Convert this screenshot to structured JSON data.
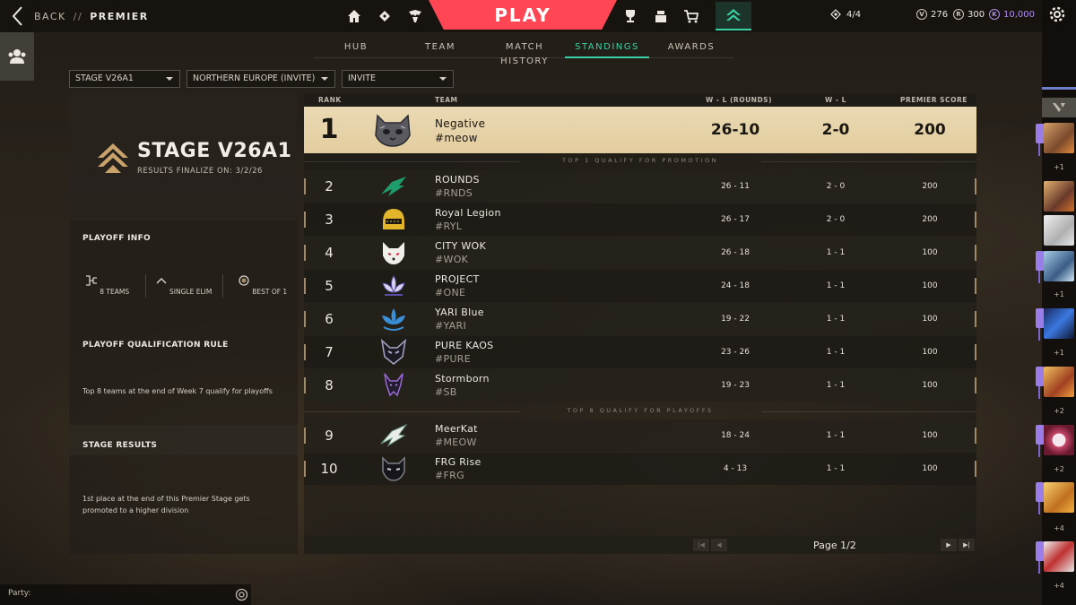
{
  "header": {
    "back_label": "BACK",
    "separator": "//",
    "breadcrumb": "PREMIER",
    "play_label": "PLAY",
    "party_count": "4/4",
    "currency": [
      {
        "icon": "valorant-points-icon",
        "value": "276"
      },
      {
        "icon": "radianite-icon",
        "value": "300"
      },
      {
        "icon": "kingdom-credits-icon",
        "value": "10,000",
        "color": "#b08cf0"
      }
    ]
  },
  "subtabs": [
    {
      "label": "HUB"
    },
    {
      "label": "TEAM"
    },
    {
      "label": "MATCH HISTORY"
    },
    {
      "label": "STANDINGS",
      "active": true
    },
    {
      "label": "AWARDS"
    }
  ],
  "filters": {
    "stage": "STAGE V26A1",
    "region": "NORTHERN EUROPE (INVITE)",
    "division": "INVITE"
  },
  "stage": {
    "title": "STAGE V26A1",
    "finalize": "RESULTS FINALIZE ON: 3/2/26"
  },
  "playoff": {
    "title": "PLAYOFF INFO",
    "items": [
      {
        "icon": "bracket-icon",
        "label": "8 TEAMS"
      },
      {
        "icon": "chevron-up-icon",
        "label": "SINGLE ELIM"
      },
      {
        "icon": "circle-dot-icon",
        "label": "BEST OF 1"
      }
    ],
    "rule_title": "PLAYOFF QUALIFICATION RULE",
    "rule_text": "Top 8 teams at the end of Week 7 qualify for playoffs",
    "results_title": "STAGE RESULTS",
    "results_text": "1st place at the end of this Premier Stage gets promoted to a higher division"
  },
  "table": {
    "headers": {
      "rank": "RANK",
      "team": "TEAM",
      "rounds": "W - L (ROUNDS)",
      "wl": "W - L",
      "score": "PREMIER SCORE"
    },
    "promo_label": "TOP 1 QUALIFY FOR PROMOTION",
    "playoff_label": "TOP 8 QUALIFY FOR PLAYOFFS",
    "rows": [
      {
        "rank": "1",
        "name": "Negative",
        "tag": "#meow",
        "rounds": "26-10",
        "wl": "2-0",
        "score": "200",
        "logo": "cat-logo-icon"
      },
      {
        "rank": "2",
        "name": "ROUNDS",
        "tag": "#RNDS",
        "rounds": "26 - 11",
        "wl": "2 - 0",
        "score": "200",
        "logo": "green-bird-logo-icon"
      },
      {
        "rank": "3",
        "name": "Royal Legion",
        "tag": "#RYL",
        "rounds": "26 - 17",
        "wl": "2 - 0",
        "score": "200",
        "logo": "helmet-logo-icon"
      },
      {
        "rank": "4",
        "name": "CITY WOK",
        "tag": "#WOK",
        "rounds": "26 - 18",
        "wl": "1 - 1",
        "score": "100",
        "logo": "fox-logo-icon"
      },
      {
        "rank": "5",
        "name": "PROJECT",
        "tag": "#ONE",
        "rounds": "24 - 18",
        "wl": "1 - 1",
        "score": "100",
        "logo": "lotus-logo-icon"
      },
      {
        "rank": "6",
        "name": "YARI Blue",
        "tag": "#YARI",
        "rounds": "19 - 22",
        "wl": "1 - 1",
        "score": "100",
        "logo": "blue-lotus-logo-icon"
      },
      {
        "rank": "7",
        "name": "PURE KAOS",
        "tag": "#PURE",
        "rounds": "23 - 26",
        "wl": "1 - 1",
        "score": "100",
        "logo": "mask-logo-icon"
      },
      {
        "rank": "8",
        "name": "Stormborn",
        "tag": "#SB",
        "rounds": "19 - 23",
        "wl": "1 - 1",
        "score": "100",
        "logo": "dragon-logo-icon"
      },
      {
        "rank": "9",
        "name": "MeerKat",
        "tag": "#MEOW",
        "rounds": "18 - 24",
        "wl": "1 - 1",
        "score": "100",
        "logo": "white-bird-logo-icon"
      },
      {
        "rank": "10",
        "name": "FRG Rise",
        "tag": "#FRG",
        "rounds": "4 - 13",
        "wl": "1 - 1",
        "score": "100",
        "logo": "cat-mask-logo-icon"
      }
    ]
  },
  "pagination": {
    "label": "Page 1/2"
  },
  "social": {
    "plus_counts": [
      "+1",
      "+1",
      "+1",
      "+2",
      "+2",
      "+4",
      "+4"
    ]
  },
  "partybar": {
    "label": "Party:"
  },
  "colors": {
    "accent": "#3ad0a5",
    "play": "#ff4655",
    "gold": "#e3cd9f",
    "party": "#9a7de8"
  }
}
